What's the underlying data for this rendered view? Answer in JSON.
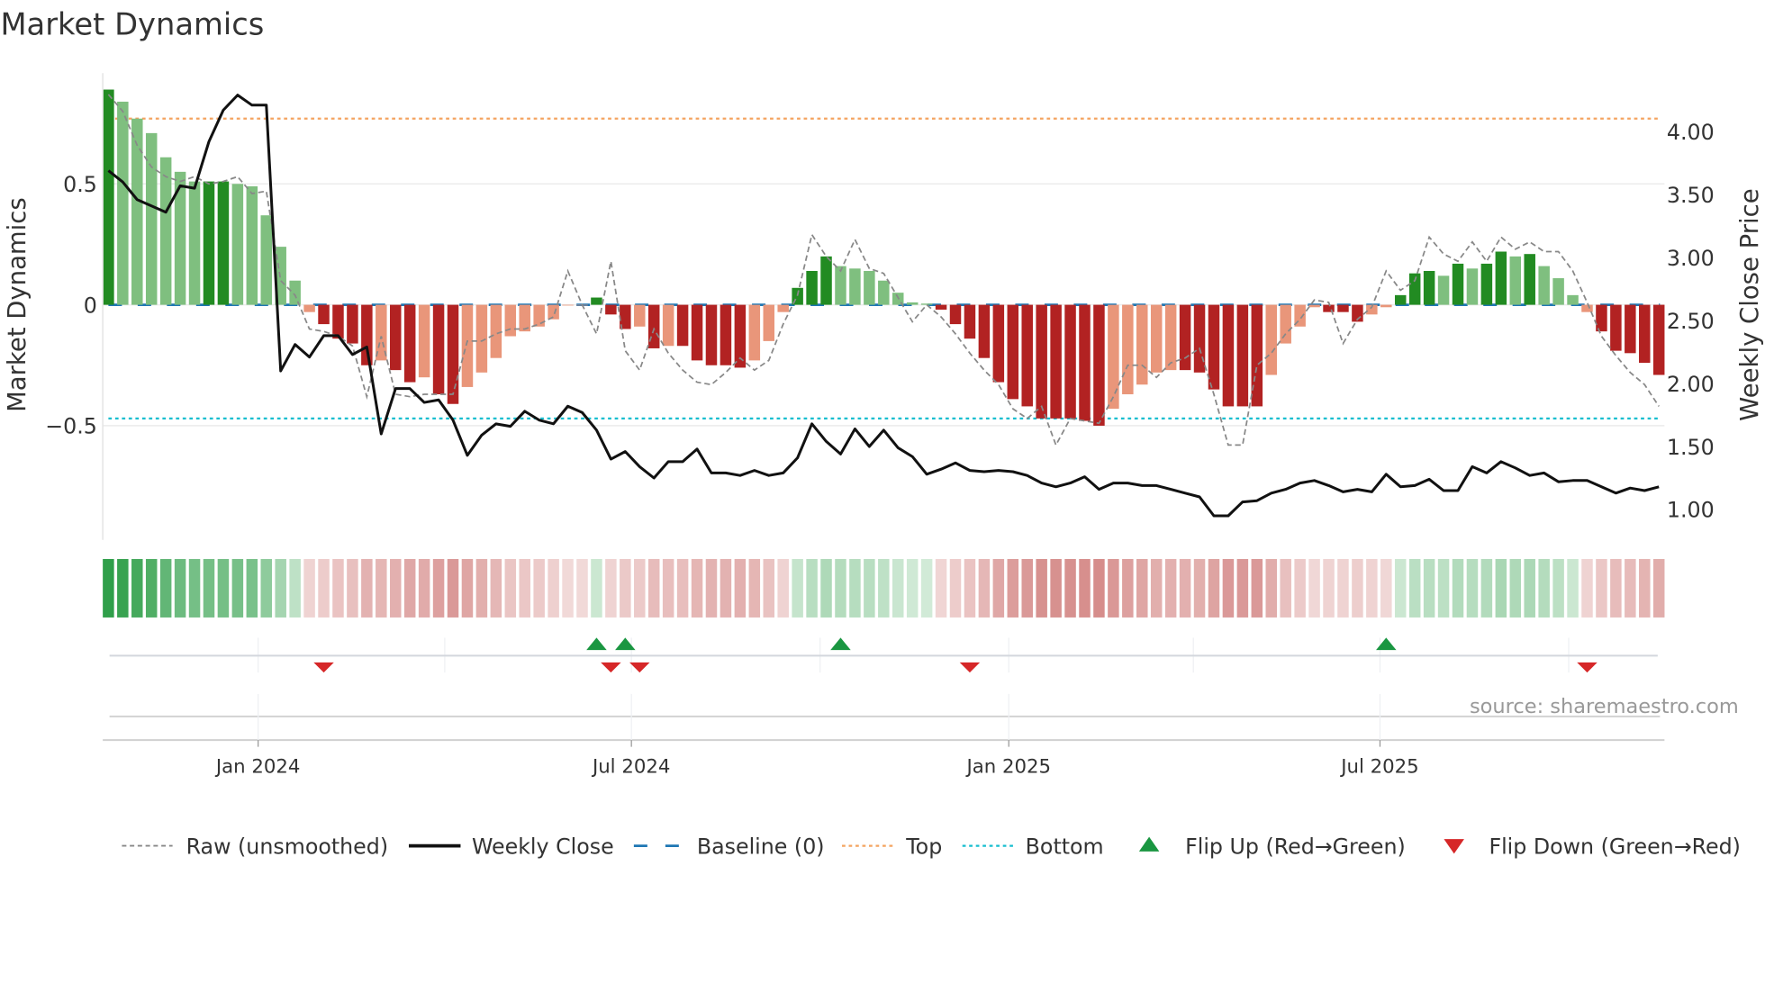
{
  "chart_data": {
    "type": "bar",
    "title": "Market Dynamics",
    "ylabel": "Market Dynamics",
    "y2label": "Weekly Close Price",
    "start_week": "2023-10-20",
    "interval_days": 7,
    "ylim": [
      -0.98,
      0.96
    ],
    "y2lim": [
      0.76,
      4.5
    ],
    "yticks": [
      {
        "v": 0.5,
        "label": "0.5"
      },
      {
        "v": 0,
        "label": "0"
      },
      {
        "v": -0.5,
        "label": "−0.5"
      }
    ],
    "y2ticks": [
      {
        "v": 4.0,
        "label": "4.00"
      },
      {
        "v": 3.5,
        "label": "3.50"
      },
      {
        "v": 3.0,
        "label": "3.00"
      },
      {
        "v": 2.5,
        "label": "2.50"
      },
      {
        "v": 2.0,
        "label": "2.00"
      },
      {
        "v": 1.5,
        "label": "1.50"
      },
      {
        "v": 1.0,
        "label": "1.00"
      }
    ],
    "xticks": [
      {
        "date": "2024-01-01",
        "label": "Jan 2024"
      },
      {
        "date": "2024-07-01",
        "label": "Jul 2024"
      },
      {
        "date": "2025-01-01",
        "label": "Jan 2025"
      },
      {
        "date": "2025-07-01",
        "label": "Jul 2025"
      }
    ],
    "quarter_gridlines": [
      "2024-01-01",
      "2024-04-01",
      "2024-07-01",
      "2024-10-01",
      "2025-01-01",
      "2025-04-01",
      "2025-07-01",
      "2025-10-01"
    ],
    "top_level": 0.77,
    "bottom_level": -0.47,
    "baseline": 0,
    "dynamics": [
      0.89,
      0.84,
      0.77,
      0.71,
      0.61,
      0.55,
      0.51,
      0.51,
      0.51,
      0.5,
      0.49,
      0.37,
      0.24,
      0.1,
      -0.03,
      -0.08,
      -0.14,
      -0.16,
      -0.25,
      -0.23,
      -0.27,
      -0.32,
      -0.3,
      -0.37,
      -0.41,
      -0.34,
      -0.28,
      -0.22,
      -0.13,
      -0.11,
      -0.09,
      -0.06,
      -0.003,
      -0.002,
      0.03,
      -0.04,
      -0.1,
      -0.09,
      -0.18,
      -0.17,
      -0.17,
      -0.23,
      -0.25,
      -0.25,
      -0.26,
      -0.23,
      -0.15,
      -0.03,
      0.07,
      0.14,
      0.2,
      0.16,
      0.15,
      0.14,
      0.1,
      0.05,
      0.01,
      0.005,
      -0.02,
      -0.08,
      -0.14,
      -0.22,
      -0.32,
      -0.39,
      -0.42,
      -0.47,
      -0.47,
      -0.47,
      -0.48,
      -0.5,
      -0.43,
      -0.37,
      -0.33,
      -0.28,
      -0.27,
      -0.27,
      -0.28,
      -0.35,
      -0.42,
      -0.42,
      -0.42,
      -0.29,
      -0.16,
      -0.09,
      -0.01,
      -0.03,
      -0.03,
      -0.07,
      -0.04,
      -0.01,
      0.04,
      0.13,
      0.14,
      0.12,
      0.17,
      0.15,
      0.17,
      0.22,
      0.2,
      0.21,
      0.16,
      0.11,
      0.04,
      -0.03,
      -0.11,
      -0.19,
      -0.2,
      -0.24,
      -0.29
    ],
    "raw": [
      0.87,
      0.8,
      0.66,
      0.57,
      0.53,
      0.51,
      0.53,
      0.5,
      0.51,
      0.53,
      0.46,
      0.47,
      0.1,
      0.04,
      -0.1,
      -0.11,
      -0.13,
      -0.17,
      -0.38,
      -0.13,
      -0.37,
      -0.38,
      -0.37,
      -0.37,
      -0.37,
      -0.15,
      -0.15,
      -0.12,
      -0.1,
      -0.1,
      -0.08,
      -0.05,
      0.14,
      0.0,
      -0.12,
      0.18,
      -0.19,
      -0.27,
      -0.1,
      -0.2,
      -0.27,
      -0.32,
      -0.33,
      -0.28,
      -0.22,
      -0.27,
      -0.23,
      -0.08,
      0.04,
      0.29,
      0.2,
      0.14,
      0.27,
      0.15,
      0.13,
      0.03,
      -0.07,
      0.0,
      -0.05,
      -0.12,
      -0.2,
      -0.27,
      -0.33,
      -0.43,
      -0.47,
      -0.42,
      -0.58,
      -0.47,
      -0.48,
      -0.49,
      -0.38,
      -0.25,
      -0.25,
      -0.3,
      -0.24,
      -0.22,
      -0.18,
      -0.37,
      -0.58,
      -0.58,
      -0.25,
      -0.2,
      -0.12,
      -0.06,
      0.02,
      0.01,
      -0.16,
      -0.06,
      -0.01,
      0.14,
      0.06,
      0.1,
      0.28,
      0.21,
      0.18,
      0.26,
      0.18,
      0.28,
      0.23,
      0.26,
      0.22,
      0.22,
      0.14,
      0.01,
      -0.13,
      -0.21,
      -0.28,
      -0.33,
      -0.42
    ],
    "weekly_close": [
      3.69,
      3.6,
      3.46,
      3.41,
      3.36,
      3.57,
      3.55,
      3.92,
      4.17,
      4.29,
      4.21,
      4.21,
      2.1,
      2.31,
      2.21,
      2.38,
      2.38,
      2.23,
      2.29,
      1.6,
      1.96,
      1.96,
      1.85,
      1.87,
      1.71,
      1.43,
      1.59,
      1.68,
      1.66,
      1.78,
      1.71,
      1.68,
      1.82,
      1.77,
      1.63,
      1.4,
      1.46,
      1.34,
      1.25,
      1.38,
      1.38,
      1.48,
      1.29,
      1.29,
      1.27,
      1.31,
      1.27,
      1.29,
      1.41,
      1.68,
      1.54,
      1.44,
      1.64,
      1.5,
      1.63,
      1.49,
      1.42,
      1.28,
      1.32,
      1.37,
      1.31,
      1.3,
      1.31,
      1.3,
      1.27,
      1.21,
      1.18,
      1.21,
      1.26,
      1.16,
      1.21,
      1.21,
      1.19,
      1.19,
      1.16,
      1.13,
      1.1,
      0.95,
      0.95,
      1.06,
      1.07,
      1.13,
      1.16,
      1.21,
      1.23,
      1.19,
      1.14,
      1.16,
      1.14,
      1.28,
      1.18,
      1.19,
      1.24,
      1.15,
      1.15,
      1.34,
      1.29,
      1.38,
      1.33,
      1.27,
      1.29,
      1.22,
      1.23,
      1.23,
      1.18,
      1.13,
      1.17,
      1.15,
      1.18
    ],
    "flip_up": [
      "2024-06-14",
      "2024-06-28",
      "2024-10-11",
      "2025-07-04"
    ],
    "flip_down": [
      "2024-02-02",
      "2024-06-21",
      "2024-07-05",
      "2024-12-13",
      "2025-10-10"
    ],
    "legend": [
      {
        "key": "raw",
        "label": "Raw (unsmoothed)"
      },
      {
        "key": "close",
        "label": "Weekly Close"
      },
      {
        "key": "baseline",
        "label": "Baseline (0)"
      },
      {
        "key": "top",
        "label": "Top"
      },
      {
        "key": "bottom",
        "label": "Bottom"
      },
      {
        "key": "up",
        "label": "Flip Up (Red→Green)"
      },
      {
        "key": "down",
        "label": "Flip Down (Green→Red)"
      }
    ],
    "source": "source: sharemaestro.com",
    "colors": {
      "green_strong": "#228b22",
      "green_fade": "#7fbf7f",
      "red_strong": "#b22222",
      "red_fade": "#e9967a",
      "close": "#111111",
      "raw": "#888888",
      "baseline": "#1f77b4",
      "top": "#f4a460",
      "bottom": "#17becf",
      "up": "#1a9641",
      "down": "#d62728"
    }
  }
}
